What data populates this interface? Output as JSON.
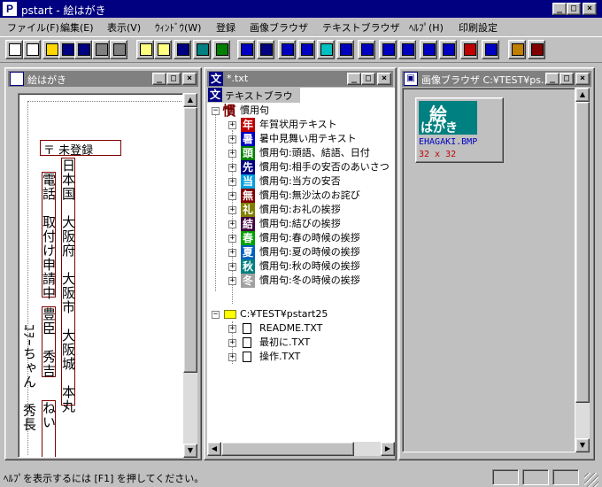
{
  "app": {
    "title": "pstart - 絵はがき",
    "icon_letter": "P"
  },
  "menu": [
    "ファイル(F)",
    "編集(E)",
    "表示(V)",
    "ｳｨﾝﾄﾞｳ(W)",
    "登録",
    "画像ブラウザ",
    "テキストブラウザ",
    "ﾍﾙﾌﾟ(H)",
    "印刷設定"
  ],
  "colors": {
    "title_active": "#000080",
    "title_inactive": "#808080",
    "face": "#c0c0c0",
    "card_border": "#800000",
    "accent_red": "#c00000",
    "link_blue": "#0000c0"
  },
  "toolbar_icons": [
    "new-doc-icon",
    "new-window-icon",
    "open-folder-icon",
    "save-icon",
    "save-all-icon",
    "print-icon",
    "print-preview-icon",
    "copy-doc-icon",
    "paste-icon",
    "move-icon",
    "fit-width-icon",
    "tree-icon",
    "align-top-icon",
    "rotate-icon",
    "space-horizontal-icon",
    "space-vertical-icon",
    "triangle-icon",
    "align-top-left-icon",
    "align-center-icon",
    "align-bottom-icon",
    "align-top-right-icon",
    "align-middle-icon",
    "align-left-icon",
    "align-right-icon",
    "align-bottom-left-icon",
    "window-icon",
    "exit-icon"
  ],
  "card_window": {
    "title": "絵はがき",
    "postal_mark": "〒 未登録",
    "address_cols": [
      "日本国　大阪府　大阪市　大阪城　本丸"
    ],
    "phone_col": "電話　取付け申請中",
    "name_col": "豊臣　秀吉",
    "recipient_col": "ねい",
    "sender_col": "ｺｦｰちゃん　秀長"
  },
  "text_window": {
    "title": "*.txt",
    "header": "テキストブラウザ",
    "root_label": "慣用句",
    "root_icon": "慣",
    "items": [
      {
        "icon": "年",
        "color": "#c00000",
        "label": "年賀状用テキスト"
      },
      {
        "icon": "暑",
        "color": "#0000c0",
        "label": "暑中見舞い用テキスト"
      },
      {
        "icon": "頭",
        "color": "#008000",
        "label": "慣用句:頭語、結語、日付"
      },
      {
        "icon": "先",
        "color": "#000080",
        "label": "慣用句:相手の安否のあいさつ"
      },
      {
        "icon": "当",
        "color": "#00a0e0",
        "label": "慣用句:当方の安否"
      },
      {
        "icon": "無",
        "color": "#800000",
        "label": "慣用句:無沙汰のお詫び"
      },
      {
        "icon": "礼",
        "color": "#808000",
        "label": "慣用句:お礼の挨拶"
      },
      {
        "icon": "結",
        "color": "#400040",
        "label": "慣用句:結びの挨拶"
      },
      {
        "icon": "春",
        "color": "#00a000",
        "label": "慣用句:春の時候の挨拶"
      },
      {
        "icon": "夏",
        "color": "#0060c0",
        "label": "慣用句:夏の時候の挨拶"
      },
      {
        "icon": "秋",
        "color": "#008080",
        "label": "慣用句:秋の時候の挨拶"
      },
      {
        "icon": "冬",
        "color": "#a0a0a0",
        "label": "慣用句:冬の時候の挨拶"
      }
    ],
    "folder_label": "C:¥TEST¥pstart25",
    "files": [
      "README.TXT",
      "最初に.TXT",
      "操作.TXT"
    ]
  },
  "image_window": {
    "title": "画像ブラウザ C:¥TEST¥ps...",
    "thumb_line1": "絵",
    "thumb_line2": "はがき",
    "file_name": "EHAGAKI.BMP",
    "dimensions": "32 x 32"
  },
  "status": {
    "text": "ﾍﾙﾌﾟを表示するには [F1] を押してください。"
  }
}
